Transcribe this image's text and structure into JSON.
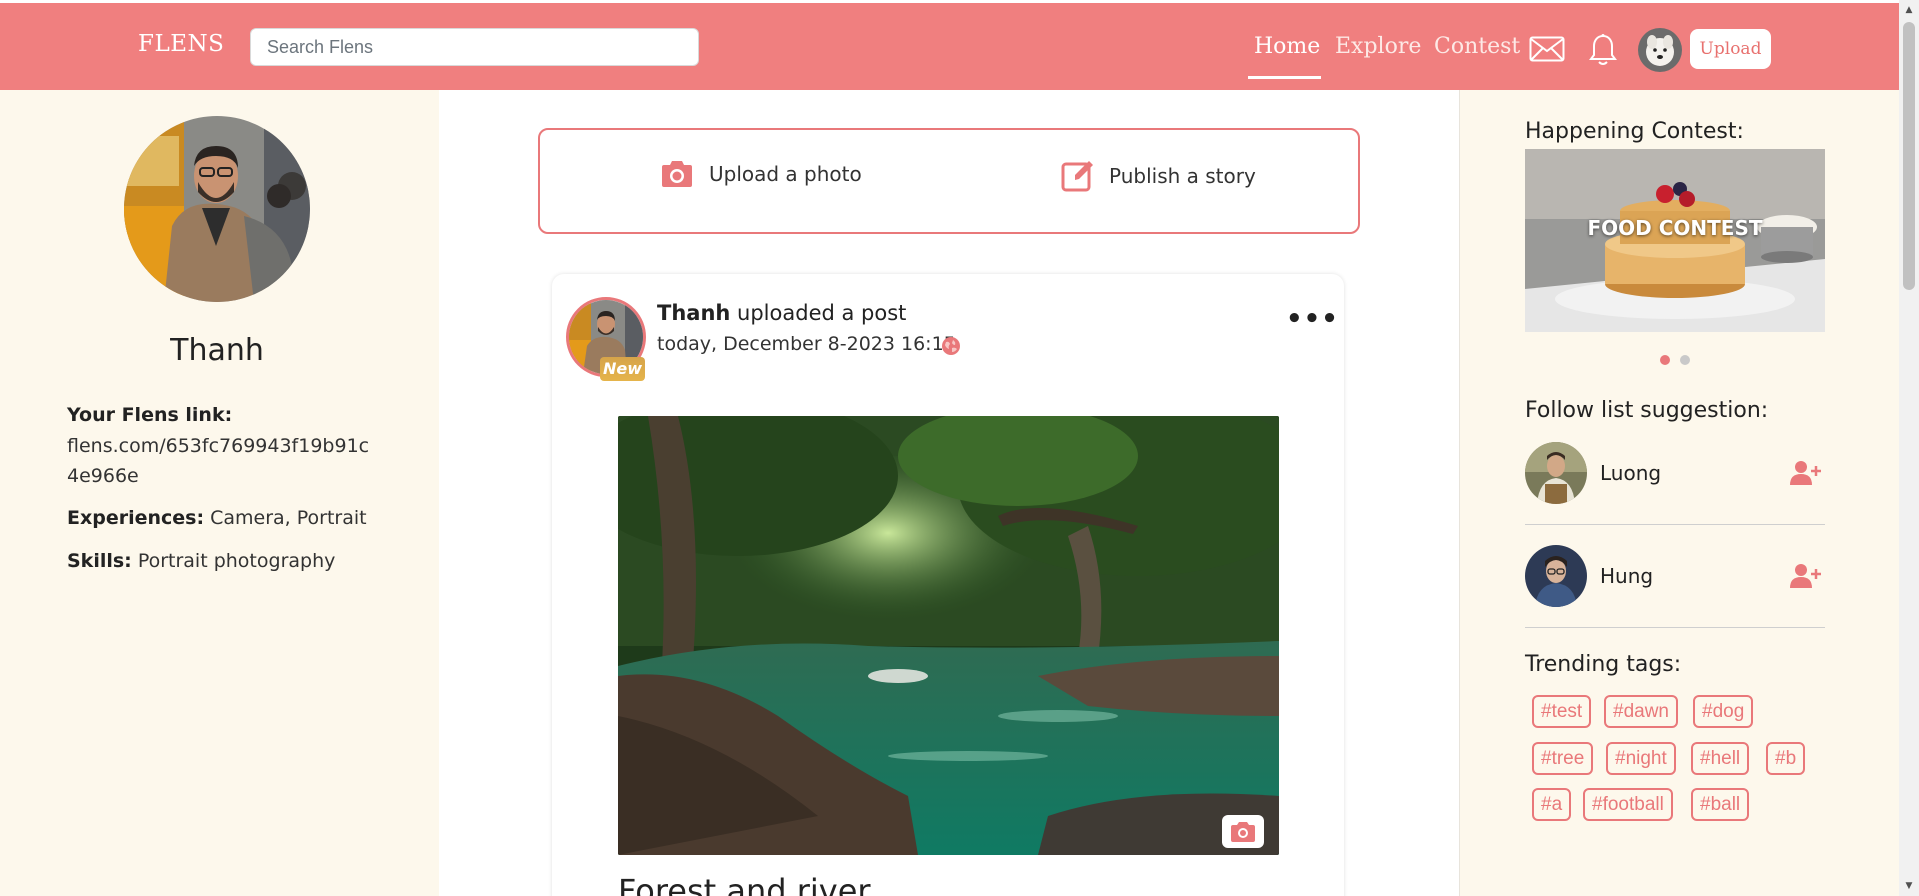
{
  "header": {
    "brand": "FLENS",
    "search_placeholder": "Search Flens",
    "nav": [
      {
        "label": "Home",
        "active": true
      },
      {
        "label": "Explore",
        "active": false
      },
      {
        "label": "Contest",
        "active": false
      }
    ],
    "icons": [
      "mail-icon",
      "bell-icon"
    ],
    "upload_label": "Upload",
    "accent_color": "#f07f7f"
  },
  "profile": {
    "name": "Thanh",
    "link_label": "Your Flens link:",
    "link_value": "flens.com/653fc769943f19b91c4e966e",
    "experiences_label": "Experiences:",
    "experiences_value": "Camera, Portrait",
    "skills_label": "Skills:",
    "skills_value": "Portrait photography"
  },
  "composer": {
    "upload_photo": "Upload a photo",
    "publish_story": "Publish a story"
  },
  "post": {
    "author": "Thanh",
    "action": "uploaded a post",
    "badge": "New",
    "time": "today, December 8-2023 16:15",
    "title": "Forest and river"
  },
  "sidebar": {
    "contest_heading": "Happening Contest:",
    "contest_banner_text": "FOOD CONTEST",
    "carousel_active_index": 0,
    "carousel_count": 2,
    "follow_heading": "Follow list suggestion:",
    "suggestions": [
      {
        "name": "Luong"
      },
      {
        "name": "Hung"
      }
    ],
    "tags_heading": "Trending tags:",
    "tags": [
      "#test",
      "#dawn",
      "#dog",
      "#tree",
      "#night",
      "#hell",
      "#b",
      "#a",
      "#football",
      "#ball"
    ]
  }
}
